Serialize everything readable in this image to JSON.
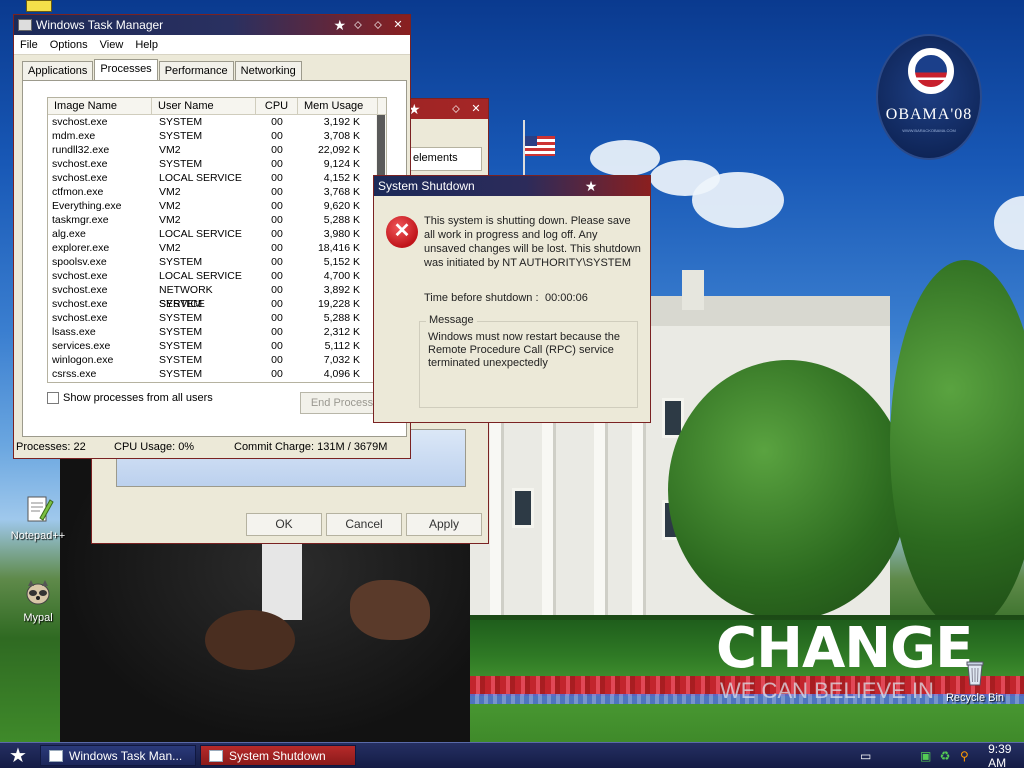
{
  "desktop": {
    "obama_logo_text": "OBAMA'08",
    "obama_logo_sub": "WWW.BARACKOBAMA.COM",
    "change_text": "CHANGE",
    "change_sub": "WE CAN BELIEVE IN",
    "icons": [
      {
        "label": "Notepad++",
        "icon": "notepad-plus-icon"
      },
      {
        "label": "Mypal",
        "icon": "mypal-raccoon-icon"
      },
      {
        "label": "Recycle Bin",
        "icon": "recycle-bin-icon"
      }
    ]
  },
  "task_manager": {
    "title": "Windows Task Manager",
    "menu": [
      "File",
      "Options",
      "View",
      "Help"
    ],
    "tabs": [
      "Applications",
      "Processes",
      "Performance",
      "Networking"
    ],
    "active_tab": "Processes",
    "columns": [
      "Image Name",
      "User Name",
      "CPU",
      "Mem Usage"
    ],
    "rows": [
      [
        "svchost.exe",
        "SYSTEM",
        "00",
        "3,192 K"
      ],
      [
        "mdm.exe",
        "SYSTEM",
        "00",
        "3,708 K"
      ],
      [
        "rundll32.exe",
        "VM2",
        "00",
        "22,092 K"
      ],
      [
        "svchost.exe",
        "SYSTEM",
        "00",
        "9,124 K"
      ],
      [
        "svchost.exe",
        "LOCAL SERVICE",
        "00",
        "4,152 K"
      ],
      [
        "ctfmon.exe",
        "VM2",
        "00",
        "3,768 K"
      ],
      [
        "Everything.exe",
        "VM2",
        "00",
        "9,620 K"
      ],
      [
        "taskmgr.exe",
        "VM2",
        "00",
        "5,288 K"
      ],
      [
        "alg.exe",
        "LOCAL SERVICE",
        "00",
        "3,980 K"
      ],
      [
        "explorer.exe",
        "VM2",
        "00",
        "18,416 K"
      ],
      [
        "spoolsv.exe",
        "SYSTEM",
        "00",
        "5,152 K"
      ],
      [
        "svchost.exe",
        "LOCAL SERVICE",
        "00",
        "4,700 K"
      ],
      [
        "svchost.exe",
        "NETWORK SERVICE",
        "00",
        "3,892 K"
      ],
      [
        "svchost.exe",
        "SYSTEM",
        "00",
        "19,228 K"
      ],
      [
        "svchost.exe",
        "SYSTEM",
        "00",
        "5,288 K"
      ],
      [
        "lsass.exe",
        "SYSTEM",
        "00",
        "2,312 K"
      ],
      [
        "services.exe",
        "SYSTEM",
        "00",
        "5,112 K"
      ],
      [
        "winlogon.exe",
        "SYSTEM",
        "00",
        "7,032 K"
      ],
      [
        "csrss.exe",
        "SYSTEM",
        "00",
        "4,096 K"
      ]
    ],
    "show_all_label": "Show processes from all users",
    "end_process_label": "End Process",
    "status": {
      "processes": "Processes: 22",
      "cpu": "CPU Usage: 0%",
      "commit": "Commit Charge: 131M / 3679M"
    }
  },
  "properties_window": {
    "partial_text": "elements",
    "ok_label": "OK",
    "cancel_label": "Cancel",
    "apply_label": "Apply"
  },
  "shutdown": {
    "title": "System Shutdown",
    "message": "This system is shutting down. Please save all work in progress and log off. Any unsaved changes will be lost. This shutdown was initiated by NT AUTHORITY\\SYSTEM",
    "time_label": "Time before shutdown :",
    "time_value": "00:00:06",
    "group_label": "Message",
    "group_text": "Windows must now restart because the Remote Procedure Call (RPC) service terminated unexpectedly"
  },
  "taskbar": {
    "tasks": [
      "Windows Task Man...",
      "System Shutdown"
    ],
    "clock": "9:39 AM"
  },
  "colors": {
    "title_blue": "#1c2a58",
    "title_red": "#8a1f1f",
    "taskbar": "#141c45"
  }
}
